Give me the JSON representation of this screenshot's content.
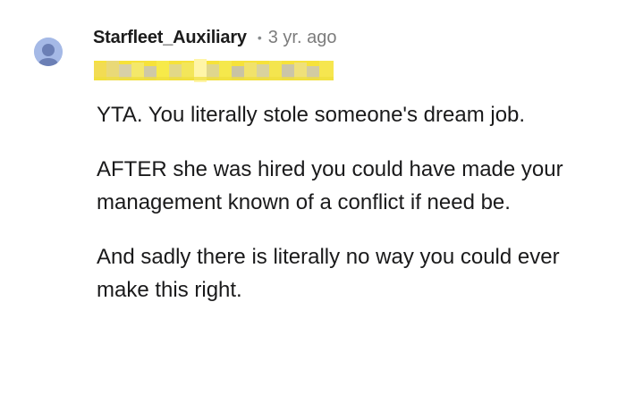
{
  "comment": {
    "author": "Starfleet_Auxiliary",
    "separator": "•",
    "timestamp": "3 yr. ago",
    "avatar_icon": "default-avatar-icon",
    "flair_redacted": true,
    "paragraphs": [
      "YTA. You literally stole someone's dream job.",
      "AFTER she was hired you could have made your management known of a conflict if need be.",
      "And sadly there is literally no way you could ever make this right."
    ]
  },
  "colors": {
    "avatar_bg": "#a5b9e6",
    "flair_highlight": "#ffee00",
    "timestamp": "#7c7c7c"
  }
}
